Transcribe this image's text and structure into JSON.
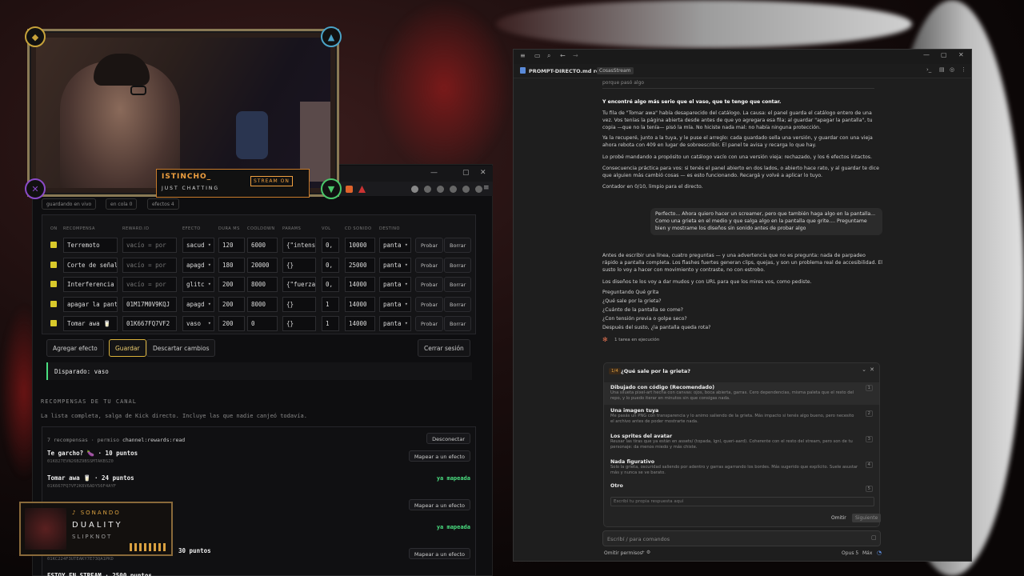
{
  "colors": {
    "accent_green": "#4ade80",
    "checkbox": "#d9c92b",
    "stream_orange": "#c77a2a"
  },
  "left_app": {
    "filters": [
      "guardando en vivo",
      "en cola 0",
      "efectos 4"
    ],
    "columns": [
      "ON",
      "RECOMPENSA",
      "REWARD.ID",
      "EFECTO",
      "DURA MS",
      "COOLDOWN",
      "PARAMS",
      "VOL",
      "CD SONIDO",
      "DESTINO"
    ],
    "rows": [
      {
        "name": "Terremoto",
        "reward": "vacío = por",
        "effect": "sacud",
        "dur": "120",
        "cooldown": "6000",
        "params": "{\"intens",
        "vol": "0,",
        "cd": "10000",
        "dest": "panta"
      },
      {
        "name": "Corte de señal",
        "reward": "vacío = por",
        "effect": "apagd",
        "dur": "180",
        "cooldown": "20000",
        "params": "{}",
        "vol": "0,",
        "cd": "25000",
        "dest": "panta"
      },
      {
        "name": "Interferencia",
        "reward": "vacío = por",
        "effect": "glitc",
        "dur": "200",
        "cooldown": "8000",
        "params": "{\"fuerza",
        "vol": "0,",
        "cd": "14000",
        "dest": "panta"
      },
      {
        "name": "apagar la pant",
        "reward": "01M17M0V9KQJ",
        "effect": "apagd",
        "dur": "200",
        "cooldown": "8000",
        "params": "{}",
        "vol": "1",
        "cd": "14000",
        "dest": "panta"
      },
      {
        "name": "Tomar awa 🥛",
        "reward": "01K667FQ7VF2",
        "effect": "vaso",
        "dur": "200",
        "cooldown": "0",
        "params": "{}",
        "vol": "1",
        "cd": "14000",
        "dest": "panta"
      }
    ],
    "row_buttons": {
      "test": "Probar",
      "delete": "Borrar"
    },
    "actions": {
      "add": "Agregar efecto",
      "save": "Guardar",
      "discard": "Descartar cambios",
      "logout": "Cerrar sesión"
    },
    "fired": "Disparado: vaso",
    "rewards_heading": "RECOMPENSAS DE TU CANAL",
    "rewards_sub": "La lista completa, salga de Kick directo. Incluye las que nadie canjeó todavía.",
    "rewards_count": "7 recompensas · permiso",
    "rewards_perm": "channel:rewards:read",
    "disconnect": "Desconectar",
    "rewards": [
      {
        "name": "Te garcho? 🍆 · 10 puntos",
        "id": "01K827EVN26BZ9BSSMTAKBSZ0",
        "action": "Mapear a un efecto"
      },
      {
        "name": "Tomar awa 🥛 · 24 puntos",
        "id": "01K667FQ7VF2K8V6ADY56F4AYF",
        "action": "ya mapeada"
      },
      {
        "name": "",
        "id": "",
        "action": "Mapear a un efecto"
      },
      {
        "name": "",
        "id": "",
        "action": "ya mapeada"
      },
      {
        "name": "30 puntos",
        "id": "01KC224F3UTEAKY7E73QA1PKD",
        "action": "Mapear a un efecto"
      },
      {
        "name": "ESTOY EN STREAM · 2500 puntos",
        "id": "",
        "action": ""
      }
    ]
  },
  "webcam": {
    "username": "ISTINCHO_",
    "category": "JUST CHATTING",
    "badge": "STREAM ON"
  },
  "music": {
    "status": "♪ SONANDO",
    "title": "DUALITY",
    "artist": "SLIPKNOT"
  },
  "right_window": {
    "doc_title": "PROMPT-DIRECTO.md review",
    "tag": "CosasStream",
    "cut_line": "porque pasó algo",
    "heading": "Y encontré algo más serio que el vaso, que te tengo que contar.",
    "para1": "Tu fila de \"Tomar awa\" había desaparecido del catálogo. La causa: el panel guarda el catálogo entero de una vez. Vos tenías la página abierta desde antes de que yo agregara esa fila; al guardar \"apagar la pantalla\", tu copia —que no la tenía— pisó la mía. No hiciste nada mal: no había ninguna protección.",
    "para2": "Ya la recuperé, junto a la tuya, y le puse el arreglo: cada guardado sella una versión, y guardar con una vieja ahora rebota con 409 en lugar de sobreescribir. El panel te avisa y recarga lo que hay.",
    "para3": "Lo probé mandando a propósito un catálogo vacío con una versión vieja: rechazado, y los 6 efectos intactos.",
    "para4": "Consecuencia práctica para vos: si tenés el panel abierto en dos lados, o abierto hace rato, y al guardar te dice que alguien más cambió cosas — es esto funcionando. Recargá y volvé a aplicar lo tuyo.",
    "para5": "Contador en 0/10, limpio para el directo.",
    "user_msg": "Perfecto... Ahora quiero hacer un screamer, pero que también haga algo en la pantalla... Como una grieta en el medio y que salga algo en la pantalla que grite.... Preguntame bien y mostrame los diseños sin sonido antes de probar algo",
    "reply1": "Antes de escribir una línea, cuatro preguntas — y una advertencia que no es pregunta: nada de parpadeo rápido a pantalla completa. Los flashes fuertes generan clips, quejas, y son un problema real de accesibilidad. El susto lo voy a hacer con movimiento y contraste, no con estrobo.",
    "reply2": "Los diseños te los voy a dar mudos y con URL para que los mires vos, como pediste.",
    "asking": "Preguntando Qué grita",
    "questions": [
      "¿Qué sale por la grieta?",
      "¿Cuánto de la pantalla se come?",
      "¿Con tensión previa o golpe seco?",
      "Después del susto, ¿la pantalla queda rota?"
    ],
    "task": "1 tarea en ejecución",
    "panel": {
      "step": "1/4",
      "title": "¿Qué sale por la grieta?",
      "options": [
        {
          "title": "Dibujado con código (Recomendado)",
          "desc": "Una silueta pixel-art hecha con canvas: ojos, boca abierta, garras. Cero dependencias, misma paleta que el resto del repo, y lo puedo iterar en minutos sin que consigas nada.",
          "n": "1"
        },
        {
          "title": "Una imagen tuya",
          "desc": "Me pasás un PNG con transparencia y lo animo saliendo de la grieta. Más impacto si tenés algo bueno, pero necesito el archivo antes de poder mostrarte nada.",
          "n": "2"
        },
        {
          "title": "Los sprites del avatar",
          "desc": "Reusar las tiras que ya están en assets/ (topada, lgnl, queri-aard). Coherente con el resto del stream, pero son de tu personaje: da menos miedo y más chiste.",
          "n": "3"
        },
        {
          "title": "Nada figurativo",
          "desc": "Solo la grieta, oscuridad saliendo por adentro y garras agarrando los bordes. Más sugerido que explícito. Suele asustar más y nunca se ve barato.",
          "n": "4"
        },
        {
          "title": "Otro",
          "desc": "",
          "n": "5"
        }
      ],
      "input_placeholder": "Escribí tu propia respuesta aquí",
      "omit": "Omitir",
      "next": "Siguiente"
    },
    "cmd_placeholder": "Escribí / para comandos",
    "footer": {
      "permissions": "Omitir permisos",
      "model": "Opus 5",
      "effort": "Máx"
    }
  }
}
